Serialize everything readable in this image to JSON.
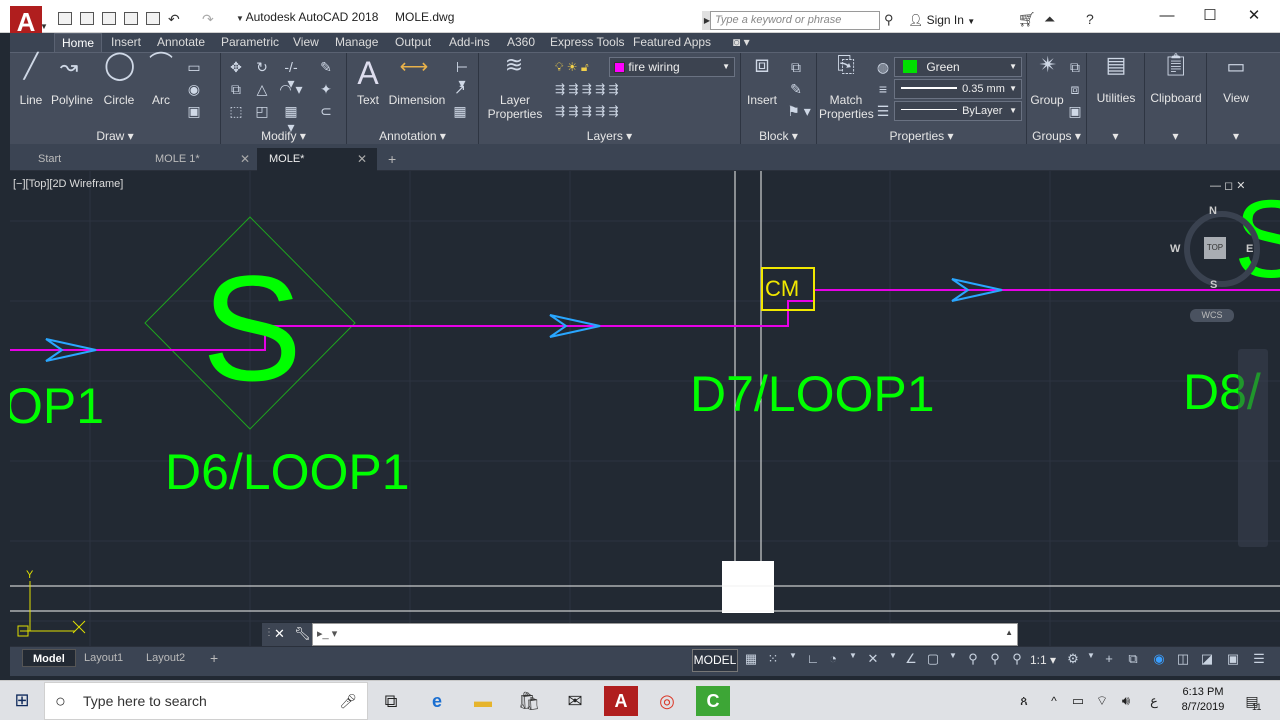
{
  "window": {
    "title": "Autodesk AutoCAD 2018     MOLE.dwg",
    "search_placeholder": "Type a keyword or phrase",
    "sign_in": "Sign In",
    "minimize": "—",
    "maximize": "☐",
    "close": "✕"
  },
  "ribbon_tabs": [
    "Home",
    "Insert",
    "Annotate",
    "Parametric",
    "View",
    "Manage",
    "Output",
    "Add-ins",
    "A360",
    "Express Tools",
    "Featured Apps"
  ],
  "draw": {
    "panel": "Draw",
    "line": "Line",
    "polyline": "Polyline",
    "circle": "Circle",
    "arc": "Arc"
  },
  "modify": {
    "panel": "Modify"
  },
  "annotation": {
    "panel": "Annotation",
    "text": "Text",
    "dimension": "Dimension"
  },
  "layers": {
    "panel": "Layers",
    "layer_properties_1": "Layer",
    "layer_properties_2": "Properties",
    "current_layer": "fire  wiring",
    "current_layer_color": "#ff00ff"
  },
  "block": {
    "panel": "Block",
    "insert": "Insert"
  },
  "properties": {
    "panel": "Properties",
    "match_1": "Match",
    "match_2": "Properties",
    "color": "Green",
    "color_swatch": "#00e000",
    "lineweight": "0.35 mm",
    "linetype": "ByLayer"
  },
  "groups": {
    "panel": "Groups",
    "group": "Group"
  },
  "utilities": "Utilities",
  "clipboard": "Clipboard",
  "view_panel": "View",
  "file_tabs": [
    {
      "label": "Start"
    },
    {
      "label": "MOLE 1*"
    },
    {
      "label": "MOLE*"
    }
  ],
  "viewport": {
    "controls": "[−][Top][2D Wireframe]",
    "cube_top": "TOP",
    "cube_n": "N",
    "cube_s": "S",
    "cube_e": "E",
    "cube_w": "W",
    "wcs": "WCS",
    "ucs_y": "Y"
  },
  "drawing": {
    "smoke_symbol": "S",
    "label_left_partial": "OP1",
    "label_d6": "D6/LOOP1",
    "label_d7": "D7/LOOP1",
    "label_d8_partial": "D8/",
    "cm": "CM",
    "wire_color": "#e600e6",
    "text_color": "#00ff00"
  },
  "layout_tabs": [
    "Model",
    "Layout1",
    "Layout2"
  ],
  "status": {
    "model": "MODEL",
    "scale": "1:1"
  },
  "taskbar": {
    "search": "Type here to search",
    "time": "6:13 PM",
    "date": "8/7/2019",
    "lang": "ع",
    "notif": "11"
  }
}
